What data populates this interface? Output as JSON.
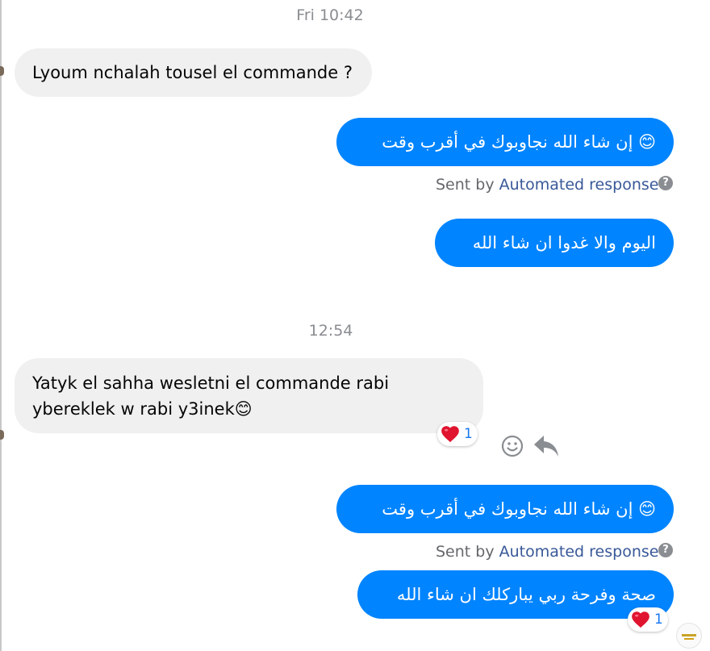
{
  "thread": {
    "timestamp_1": "Fri 10:42",
    "timestamp_2": "12:54",
    "messages": [
      {
        "text": "Lyoum nchalah tousel el commande ?"
      },
      {
        "text": "😊 إن شاء الله نجاوبوك في أقرب وقت"
      },
      {
        "text": "اليوم والا غدوا  ان شاء الله"
      },
      {
        "text_line1": "Yatyk el sahha wesletni el commande rabi",
        "text_line2": "ybereklek w rabi y3inek😊",
        "reaction_count": "1"
      },
      {
        "text": "😊 إن شاء الله نجاوبوك في أقرب وقت"
      },
      {
        "text": "صحة وفرحة ربي يباركلك ان شاء الله",
        "reaction_count": "1"
      }
    ],
    "sent_by": {
      "prefix": "Sent by",
      "link": "Automated response",
      "help_icon": "?"
    }
  },
  "icons": {
    "reaction": "heart-icon",
    "react_button": "smiley-icon",
    "reply_button": "reply-arrow-icon",
    "info": "help-icon"
  },
  "colors": {
    "outgoing": "#0084ff",
    "incoming": "#f0f0f0",
    "link": "#385898",
    "meta": "#65676b"
  }
}
